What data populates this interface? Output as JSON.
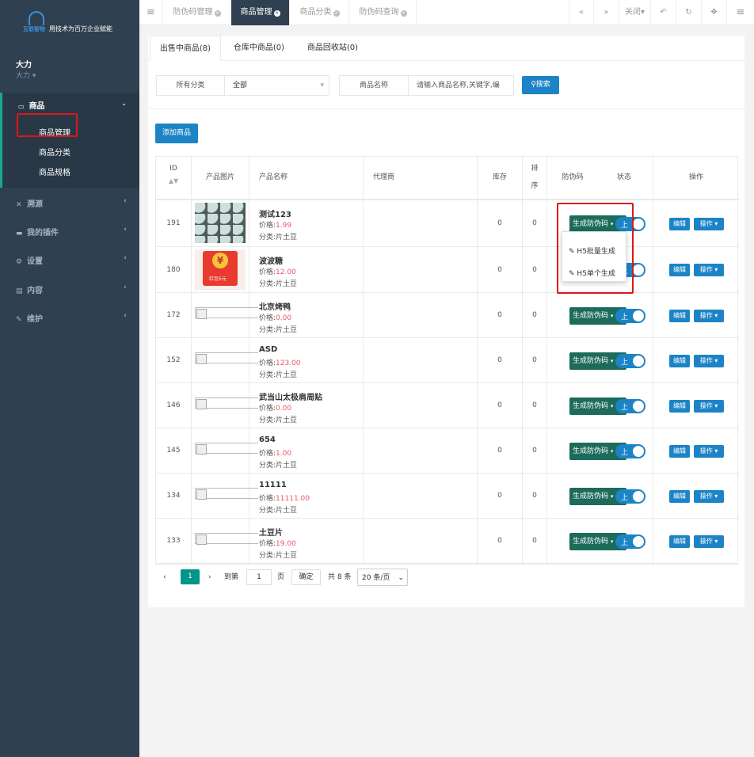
{
  "sidebar": {
    "logo_name": "互联智物",
    "slogan": "用技术为百万企业赋能",
    "user_name": "大力",
    "user_role": "大力",
    "menu": [
      {
        "label": "商品",
        "icon": "monitor-icon"
      },
      {
        "label": "溯源",
        "icon": "x-icon"
      },
      {
        "label": "我的插件",
        "icon": "keyboard-icon"
      },
      {
        "label": "设置",
        "icon": "gear-icon"
      },
      {
        "label": "内容",
        "icon": "book-icon"
      },
      {
        "label": "维护",
        "icon": "wrench-icon"
      }
    ],
    "submenu": [
      "商品管理",
      "商品分类",
      "商品规格"
    ]
  },
  "topbar": {
    "tabs": [
      "防伪码管理",
      "商品管理",
      "商品分类",
      "防伪码查询"
    ],
    "close_label": "关闭"
  },
  "page": {
    "tabs": [
      "出售中商品(8)",
      "仓库中商品(0)",
      "商品回收站(0)"
    ],
    "filter_category_label": "所有分类",
    "filter_category_value": "全部",
    "filter_name_label": "商品名称",
    "search_placeholder": "请输入商品名称,关键字,编",
    "search_button": "搜索",
    "add_button": "添加商品"
  },
  "table": {
    "headers": {
      "id": "ID",
      "image": "产品图片",
      "name": "产品名称",
      "agent": "代理商",
      "stock": "库存",
      "sort": "排序",
      "code": "防伪码",
      "status": "状态",
      "action": "操作"
    },
    "gen_label": "生成防伪码",
    "toggle_label": "上",
    "edit_label": "编辑",
    "op_label": "操作",
    "price_prefix": "价格:",
    "rows": [
      {
        "id": "191",
        "name": "测试123",
        "price": "1.99",
        "category": "分类:片土豆",
        "stock": "0",
        "sort": "0",
        "img": "photo"
      },
      {
        "id": "180",
        "name": "波波糖",
        "price": "12.00",
        "category": "分类:片土豆",
        "stock": "0",
        "sort": "0",
        "img": "redpacket"
      },
      {
        "id": "172",
        "name": "北京烤鸭",
        "price": "0.00",
        "category": "分类:片土豆",
        "stock": "0",
        "sort": "0",
        "img": "broken"
      },
      {
        "id": "152",
        "name": "ASD",
        "price": "123.00",
        "category": "分类:片土豆",
        "stock": "0",
        "sort": "0",
        "img": "broken"
      },
      {
        "id": "146",
        "name": "武当山太极肩周贴",
        "price": "0.00",
        "category": "分类:片土豆",
        "stock": "0",
        "sort": "0",
        "img": "broken"
      },
      {
        "id": "145",
        "name": "654",
        "price": "1.00",
        "category": "分类:片土豆",
        "stock": "0",
        "sort": "0",
        "img": "broken"
      },
      {
        "id": "134",
        "name": "11111",
        "price": "11111.00",
        "category": "分类:片土豆",
        "stock": "0",
        "sort": "0",
        "img": "broken"
      },
      {
        "id": "133",
        "name": "土豆片",
        "price": "19.00",
        "category": "分类:片土豆",
        "stock": "0",
        "sort": "0",
        "img": "broken"
      }
    ]
  },
  "dropdown": {
    "items": [
      "H5批量生成",
      "H5单个生成"
    ]
  },
  "pager": {
    "current": "1",
    "goto_label": "到第",
    "page_input": "1",
    "page_unit": "页",
    "confirm": "确定",
    "total": "共 8 条",
    "per_page": "20 条/页"
  },
  "redpacket_text": "¥",
  "redpacket_caption": "红包5元"
}
